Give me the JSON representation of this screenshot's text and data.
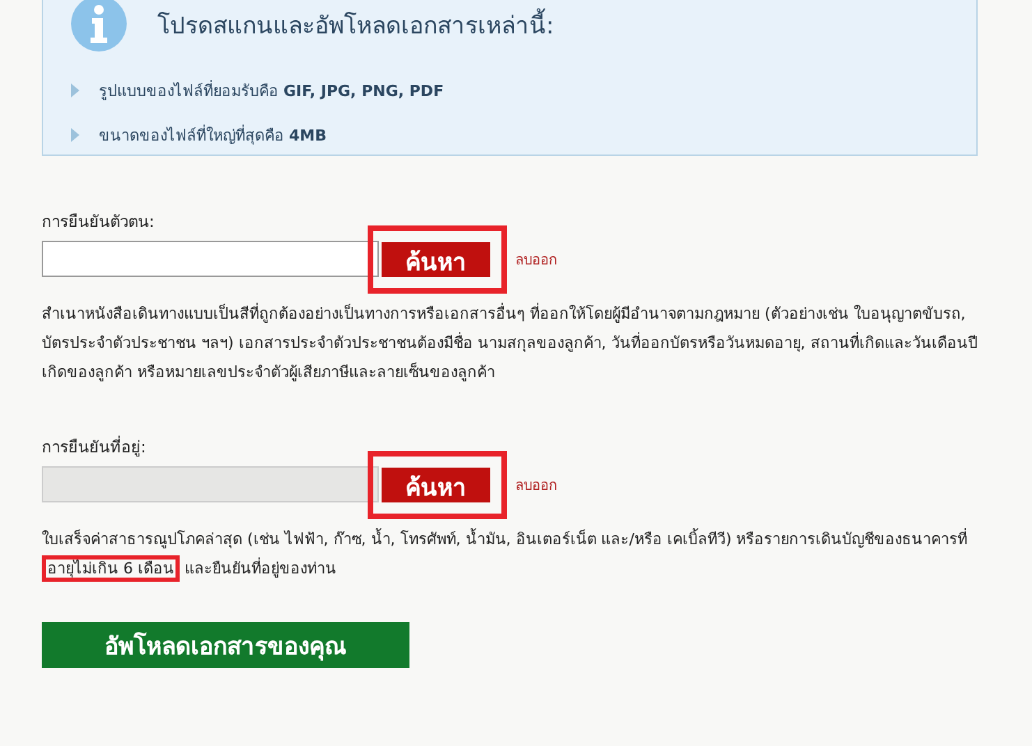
{
  "info": {
    "title": "โปรดสแกนและอัพโหลดเอกสารเหล่านี้:",
    "items": [
      "รูปแบบของไฟล์ที่ยอมรับคือ **GIF, JPG, PNG, PDF**",
      "ขนาดของไฟล์ที่ใหญ่ที่สุดคือ **4MB**"
    ]
  },
  "sections": [
    {
      "label": "การยืนยันตัวตน:",
      "disabled": false,
      "button": "ค้นหา",
      "button_highlighted": true,
      "remove": "ลบออก",
      "description": [
        {
          "text": "สำเนาหนังสือเดินทางแบบเป็นสีที่ถูกต้องอย่างเป็นทางการหรือเอกสารอื่นๆ ที่ออกให้โดยผู้มีอำนาจตามกฎหมาย (ตัวอย่างเช่น ใบอนุญาตขับรถ, บัตรประจำตัวประชาชน ฯลฯ) เอกสารประจำตัวประชาชนต้องมีชื่อ นามสกุลของลูกค้า, วันที่ออกบัตรหรือวันหมดอายุ, สถานที่เกิดและวันเดือนปีเกิดของลูกค้า หรือหมายเลขประจำตัวผู้เสียภาษีและลายเซ็นของลูกค้า",
          "highlighted": false
        }
      ]
    },
    {
      "label": "การยืนยันที่อยู่:",
      "disabled": true,
      "button": "ค้นหา",
      "button_highlighted": true,
      "remove": "ลบออก",
      "description": [
        {
          "text": "ใบเสร็จค่าสาธารณูปโภคล่าสุด (เช่น ไฟฟ้า, ก๊าซ, น้ำ, โทรศัพท์, น้ำมัน, อินเตอร์เน็ต และ/หรือ เคเบิ้ลทีวี) หรือรายการเดินบัญชีของธนาคารที่",
          "highlighted": false
        },
        {
          "text": "อายุไม่เกิน 6 เดือน",
          "highlighted": true
        },
        {
          "text": " และยืนยันที่อยู่ของท่าน",
          "highlighted": false
        }
      ]
    }
  ],
  "upload_button": "อัพโหลดเอกสารของคุณ"
}
